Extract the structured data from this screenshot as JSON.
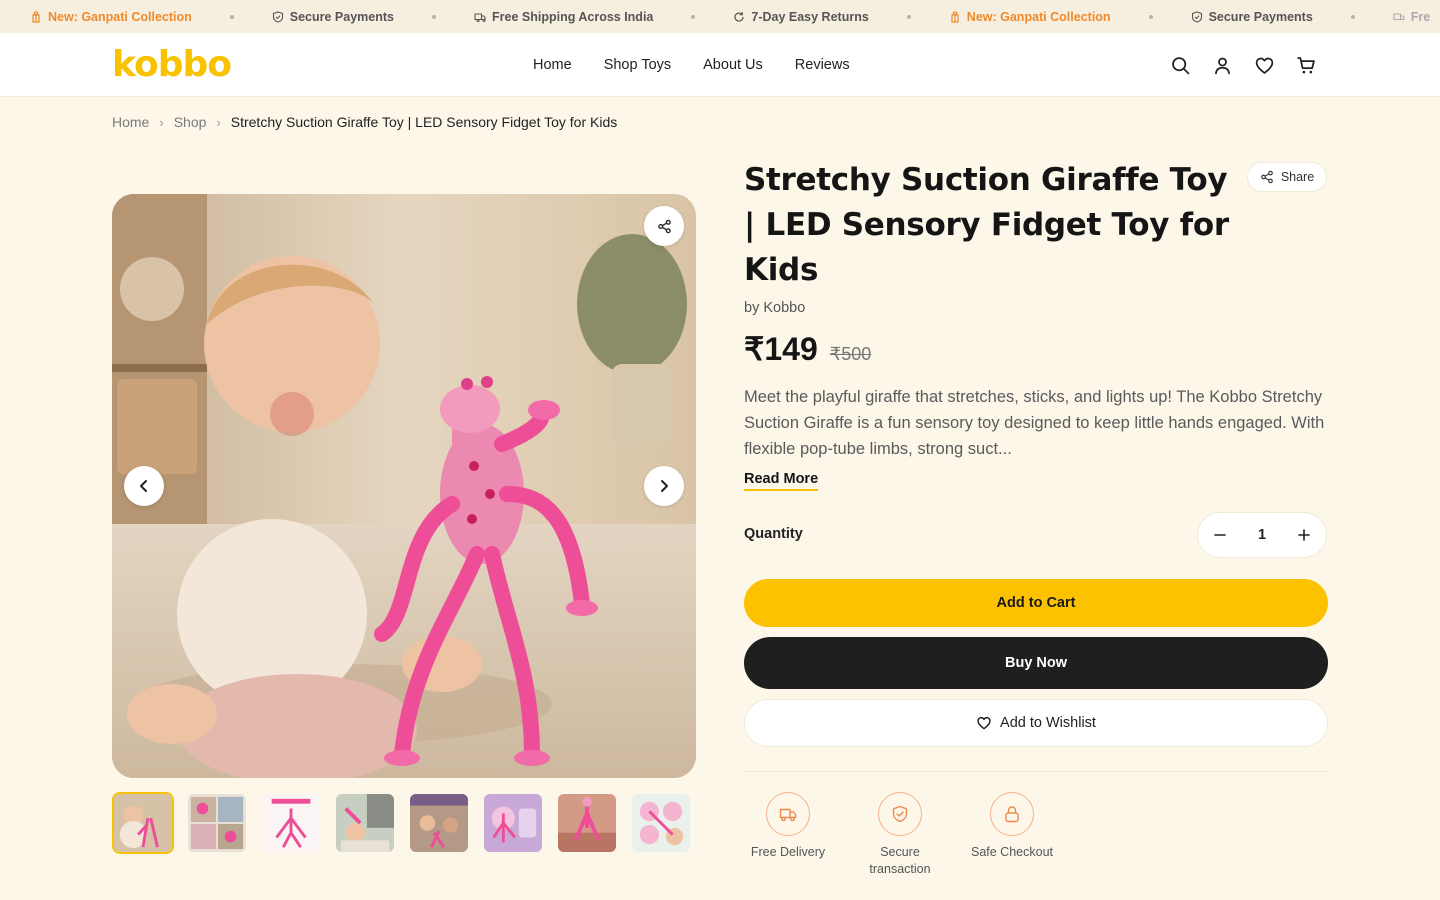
{
  "announcement": {
    "items": [
      {
        "text": "New: Ganpati Collection",
        "icon": "gift-icon",
        "highlight": true
      },
      {
        "text": "Secure Payments",
        "icon": "shield-icon",
        "highlight": false
      },
      {
        "text": "Free Shipping Across India",
        "icon": "truck-icon",
        "highlight": false
      },
      {
        "text": "7-Day Easy Returns",
        "icon": "refresh-icon",
        "highlight": false
      },
      {
        "text": "New: Ganpati Collection",
        "icon": "gift-icon",
        "highlight": true
      },
      {
        "text": "Secure Payments",
        "icon": "shield-icon",
        "highlight": false
      },
      {
        "text": "Fre",
        "icon": "truck-icon",
        "highlight": false
      }
    ]
  },
  "header": {
    "logo": "kobbo",
    "nav": [
      "Home",
      "Shop Toys",
      "About Us",
      "Reviews"
    ],
    "icons": [
      "search-icon",
      "user-icon",
      "heart-icon",
      "cart-icon"
    ]
  },
  "breadcrumb": {
    "home": "Home",
    "shop": "Shop",
    "current": "Stretchy Suction Giraffe Toy | LED Sensory Fidget Toy for Kids"
  },
  "product": {
    "title": "Stretchy Suction Giraffe Toy | LED Sensory Fidget Toy for Kids",
    "share_label": "Share",
    "byline": "by Kobbo",
    "price": "₹149",
    "original_price": "₹500",
    "description": "Meet the playful giraffe that stretches, sticks, and lights up! The Kobbo Stretchy Suction Giraffe is a fun sensory toy designed to keep little hands engaged. With flexible pop-tube limbs, strong suct...",
    "read_more": "Read More",
    "quantity_label": "Quantity",
    "quantity": "1",
    "add_to_cart": "Add to Cart",
    "buy_now": "Buy Now",
    "add_to_wishlist": "Add to Wishlist"
  },
  "gallery": {
    "thumbnail_count": 8,
    "active_index": 0
  },
  "badges": [
    {
      "label": "Free Delivery",
      "icon": "truck-icon"
    },
    {
      "label": "Secure transaction",
      "icon": "shield-icon"
    },
    {
      "label": "Safe Checkout",
      "icon": "lock-icon"
    }
  ],
  "colors": {
    "accent": "#fcc200",
    "highlight": "#f08a2b",
    "background": "#fdf7ea",
    "dark_button": "#1f1f1f"
  }
}
